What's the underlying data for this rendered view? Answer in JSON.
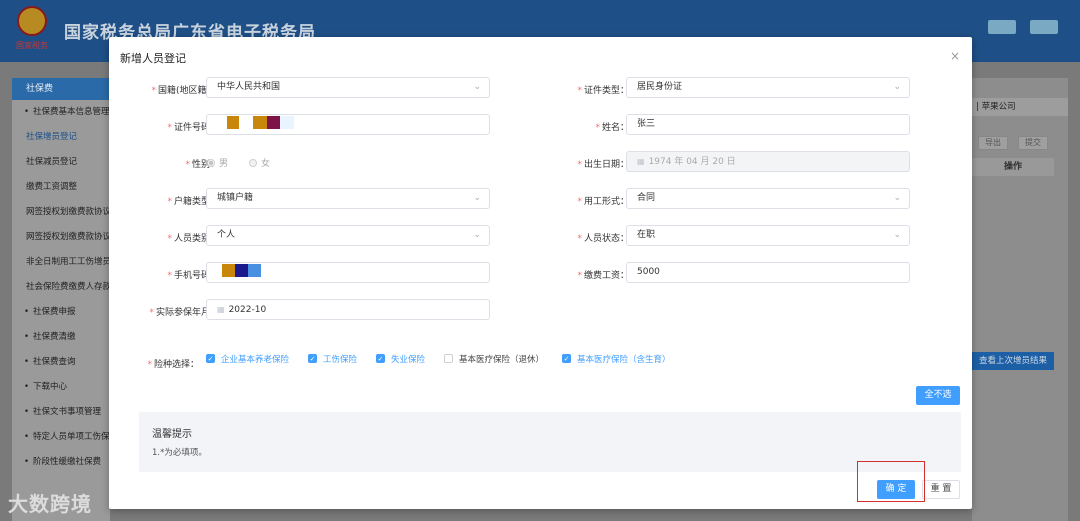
{
  "app": {
    "title": "国家税务总局广东省电子税务局",
    "logo_text": "国家税务"
  },
  "sidebar": {
    "header": "社保费",
    "items": [
      {
        "label": "社保费基本信息管理",
        "top": true
      },
      {
        "label": "社保增员登记",
        "active": true
      },
      {
        "label": "社保减员登记"
      },
      {
        "label": "缴费工资调整"
      },
      {
        "label": "网签授权划缴费款协议"
      },
      {
        "label": "网签授权划缴费款协议"
      },
      {
        "label": "非全日制用工工伤增员"
      },
      {
        "label": "社会保险费缴费人存款"
      },
      {
        "label": "社保费申报",
        "top": true
      },
      {
        "label": "社保费清缴",
        "top": true
      },
      {
        "label": "社保费查询",
        "top": true
      },
      {
        "label": "下载中心",
        "top": true
      },
      {
        "label": "社保文书事项管理",
        "top": true
      },
      {
        "label": "特定人员单项工伤保险",
        "top": true
      },
      {
        "label": "阶段性缓缴社保费",
        "top": true
      }
    ]
  },
  "background": {
    "company": "| 苹果公司",
    "export_btn": "导出",
    "submit_btn": "提交",
    "col_op": "操作",
    "last_result_btn": "查看上次增员结果",
    "watermark": "大数跨境"
  },
  "modal": {
    "title": "新增人员登记",
    "close_icon": "×",
    "fields": {
      "nationality": {
        "label": "国籍(地区籍)：",
        "value": "中华人民共和国"
      },
      "id_type": {
        "label": "证件类型：",
        "value": "居民身份证"
      },
      "id_number": {
        "label": "证件号码："
      },
      "name": {
        "label": "姓名：",
        "value": "张三"
      },
      "gender": {
        "label": "性别：",
        "options": [
          "男",
          "女"
        ],
        "selected": "男"
      },
      "birth_date": {
        "label": "出生日期：",
        "value": "1974 年 04 月 20 日"
      },
      "household_type": {
        "label": "户籍类型：",
        "value": "城镇户籍"
      },
      "employment_form": {
        "label": "用工形式：",
        "value": "合同"
      },
      "person_category": {
        "label": "人员类别：",
        "value": "个人"
      },
      "person_status": {
        "label": "人员状态：",
        "value": "在职"
      },
      "phone": {
        "label": "手机号码："
      },
      "salary": {
        "label": "缴费工资：",
        "value": "5000"
      },
      "start_month": {
        "label": "实际参保年月：",
        "value": "2022-10"
      }
    },
    "insurance": {
      "label": "险种选择：",
      "items": [
        {
          "label": "企业基本养老保险",
          "checked": true
        },
        {
          "label": "工伤保险",
          "checked": true
        },
        {
          "label": "失业保险",
          "checked": true
        },
        {
          "label": "基本医疗保险（退休）",
          "checked": false
        },
        {
          "label": "基本医疗保险（含生育）",
          "checked": true
        }
      ]
    },
    "deselect_all_btn": "全不选",
    "tips": {
      "title": "温馨提示",
      "text": "1.*为必填项。"
    },
    "confirm_btn": "确 定",
    "reset_btn": "重 置"
  },
  "colors": {
    "primary": "#409eff",
    "required": "#f56c6c",
    "highlight": "#d32f2f",
    "mask_colors": [
      "#c8860a",
      "#c8860a",
      "#7d1346",
      "#c8860a",
      "#1a1a8c",
      "#4a90e2",
      "#e8f4ff"
    ]
  }
}
